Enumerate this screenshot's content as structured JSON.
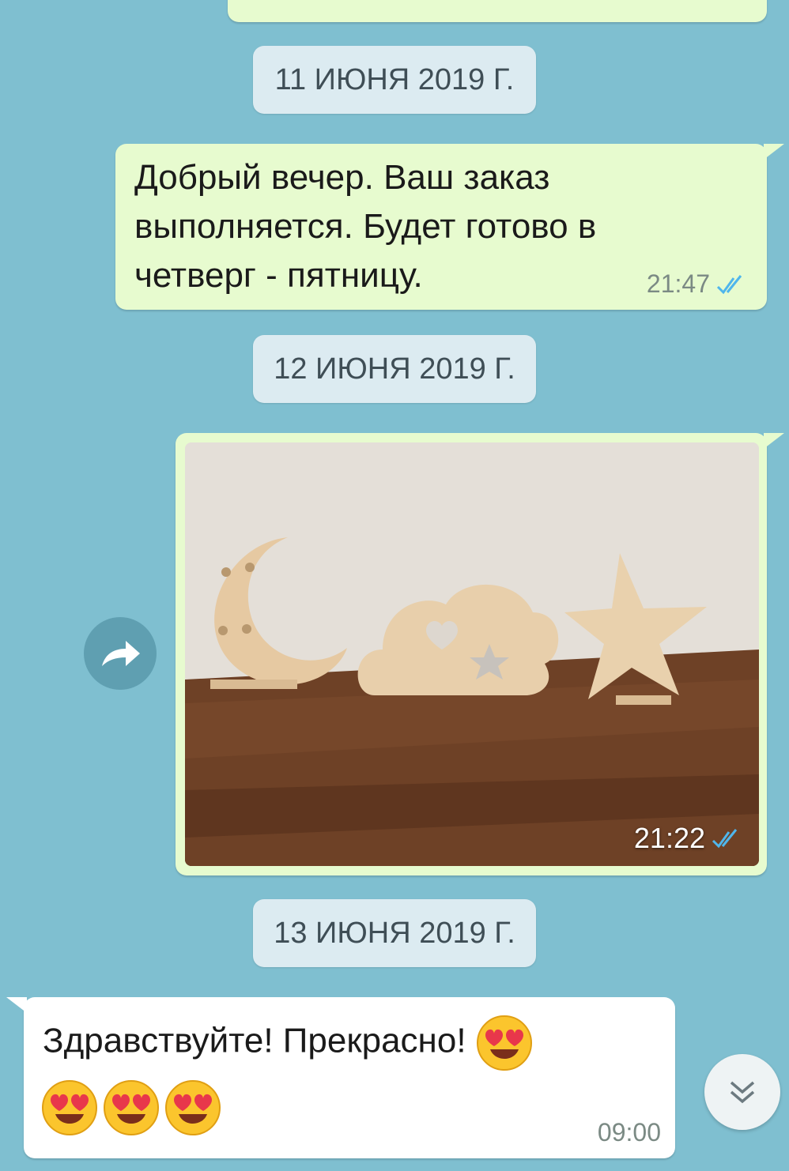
{
  "chat": {
    "dates": [
      "11 ИЮНЯ 2019 Г.",
      "12 ИЮНЯ 2019 Г.",
      "13 ИЮНЯ 2019 Г."
    ],
    "messages": [
      {
        "direction": "outgoing",
        "lines": [
          "Добрый вечер. Ваш заказ",
          "выполняется. Будет готово в",
          "четверг - пятницу."
        ],
        "time": "21:47",
        "status": "read"
      },
      {
        "direction": "outgoing",
        "type": "photo",
        "time": "21:22",
        "status": "read"
      },
      {
        "direction": "incoming",
        "text": "Здравствуйте! Прекрасно!",
        "time": "09:00"
      }
    ]
  },
  "icons": {
    "forward": "forward-arrow-icon",
    "scroll_down": "chevron-double-down-icon",
    "read_ticks": "double-check-icon"
  },
  "colors": {
    "background": "#7fbfd0",
    "outgoing_bubble": "#e7fbcf",
    "incoming_bubble": "#ffffff",
    "read_ticks": "#4fb6ec"
  }
}
